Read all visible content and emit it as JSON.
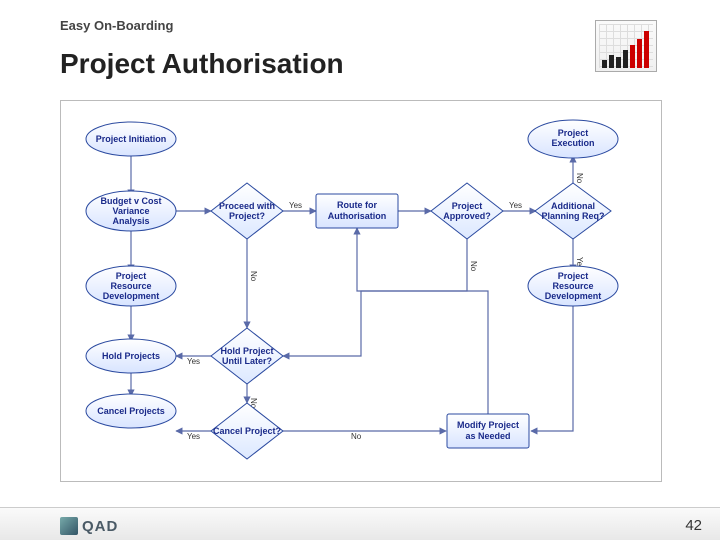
{
  "header": {
    "sub": "Easy On-Boarding",
    "main": "Project Authorisation"
  },
  "logo": {
    "text": "QAD"
  },
  "page": "42",
  "nodes": {
    "init": "Project Initiation",
    "exec": "Project Execution",
    "budget1": "Budget v Cost",
    "budget2": "Variance",
    "budget3": "Analysis",
    "proceed1": "Proceed with",
    "proceed2": "Project?",
    "route1": "Route for",
    "route2": "Authorisation",
    "approved1": "Project",
    "approved2": "Approved?",
    "addplan1": "Additional",
    "addplan2": "Planning Req?",
    "resdev1": "Project",
    "resdev2": "Resource",
    "resdev3": "Development",
    "holdE": "Hold Projects",
    "holdD1": "Hold Project",
    "holdD2": "Until Later?",
    "cancelE": "Cancel Projects",
    "cancelD": "Cancel Project?",
    "modify1": "Modify Project",
    "modify2": "as Needed"
  },
  "labels": {
    "yes": "Yes",
    "no": "No"
  }
}
